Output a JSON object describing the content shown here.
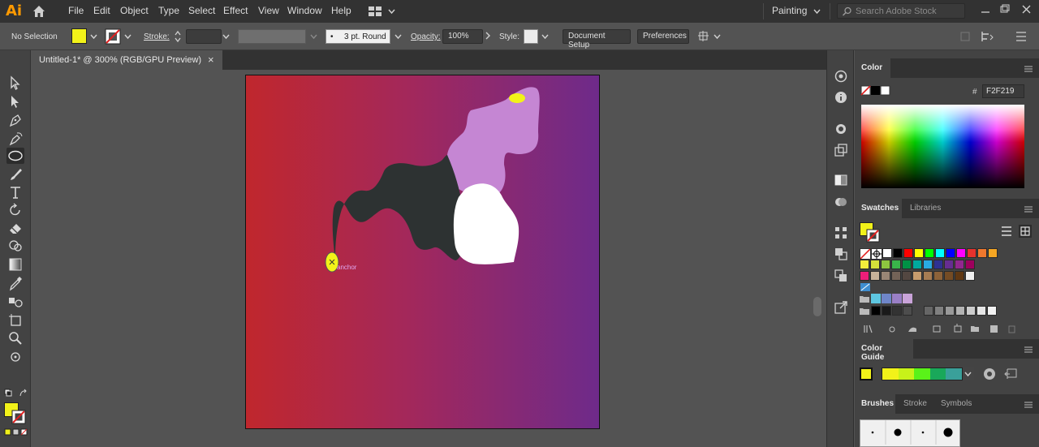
{
  "app": {
    "logo": "Ai",
    "workspace": "Painting",
    "search_placeholder": "Search Adobe Stock"
  },
  "menu": [
    "File",
    "Edit",
    "Object",
    "Type",
    "Select",
    "Effect",
    "View",
    "Window",
    "Help"
  ],
  "control_bar": {
    "selection": "No Selection",
    "stroke_label": "Stroke:",
    "brush": "3 pt. Round",
    "opacity_label": "Opacity:",
    "opacity_value": "100%",
    "style_label": "Style:",
    "document_setup": "Document Setup",
    "preferences": "Preferences"
  },
  "document_tab": {
    "title": "Untitled-1* @ 300% (RGB/GPU Preview)",
    "close": "×"
  },
  "canvas": {
    "anchor_hint": "anchor"
  },
  "color_panel": {
    "title": "Color",
    "hex_label": "#",
    "hex_value": "F2F219"
  },
  "swatches_panel": {
    "tab_active": "Swatches",
    "tab_other": "Libraries"
  },
  "color_guide_panel": {
    "title": "Color Guide"
  },
  "brushes_panel": {
    "tab_active": "Brushes",
    "tab_stroke": "Stroke",
    "tab_symbols": "Symbols"
  },
  "colors": {
    "fill": "#f2f219",
    "swatch_row1": [
      "#ffffff",
      "#000000",
      "#ff0000",
      "#ffff00",
      "#00ff00",
      "#00ffff",
      "#0000ff",
      "#ff00ff",
      "#e6322d",
      "#f0782d",
      "#f5a623"
    ],
    "swatch_row2": [
      "#f5ee3b",
      "#d4e03a",
      "#8dc63f",
      "#39b54a",
      "#009245",
      "#00a99d",
      "#29abe2",
      "#2e3192",
      "#662d91",
      "#92278f",
      "#9e005d"
    ],
    "swatch_row3": [
      "#ed1e79",
      "#c7b299",
      "#998675",
      "#736357",
      "#534741",
      "#c69c6d",
      "#a67c52",
      "#8c6239",
      "#754c24",
      "#603813",
      "#f0f0f0"
    ],
    "guide": [
      "#f2f219",
      "#c8f219",
      "#5af219",
      "#19a85a",
      "#3aa09a"
    ]
  }
}
